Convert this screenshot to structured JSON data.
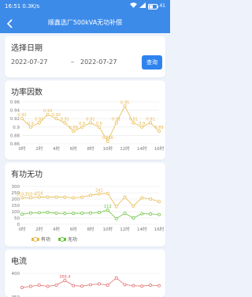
{
  "status": {
    "time": "16:51",
    "speed": "0.3K/s",
    "battery": "41"
  },
  "appbar": {
    "title": "顺鑫选厂500kVA无功补偿"
  },
  "date_card": {
    "title": "选择日期",
    "start": "2022-07-27",
    "sep": "–",
    "end": "2022-07-27",
    "query": "查询"
  },
  "pf_card": {
    "title": "功率因数"
  },
  "rp_card": {
    "title": "有功无功",
    "legend_active": "有功",
    "legend_reactive": "无功"
  },
  "cur_card": {
    "title": "电流"
  },
  "colors": {
    "primary": "#3d8be9",
    "active_series": "#e7b84a",
    "reactive_series": "#67c23a",
    "current_series": "#e36b6b"
  },
  "chart_data": [
    {
      "type": "line",
      "title": "功率因数",
      "categories": [
        "0时",
        "1时",
        "2时",
        "3时",
        "4时",
        "5时",
        "6时",
        "7时",
        "8时",
        "9时",
        "10时",
        "11时",
        "12时",
        "13时",
        "14时",
        "15时",
        "16时"
      ],
      "ylim": [
        0.86,
        0.96
      ],
      "yticks": [
        "0.96",
        "0.94",
        "0.92",
        "0.9",
        "0.88",
        "0.86"
      ],
      "series": [
        {
          "values": [
            0.92,
            0.9,
            0.91,
            0.93,
            0.92,
            0.91,
            0.89,
            0.9,
            0.91,
            0.9,
            0.866,
            0.91,
            0.95,
            0.91,
            0.9,
            0.91,
            0.89
          ]
        }
      ],
      "labels": [
        "0.92",
        "0.9",
        "0.91",
        "0.93",
        "0.92",
        "0.91",
        "0.89",
        "0.9",
        "0.91",
        "0.9",
        "0.866",
        "0.91",
        "0.95",
        "0.91",
        "0.9",
        "0.91",
        "0.89"
      ],
      "grid": true
    },
    {
      "type": "line",
      "title": "有功无功",
      "categories": [
        "0时",
        "1时",
        "2时",
        "3时",
        "4时",
        "5时",
        "6时",
        "7时",
        "8时",
        "9时",
        "10时",
        "11时",
        "12时",
        "13时",
        "14时",
        "15时",
        "16时"
      ],
      "ylim": [
        0,
        300
      ],
      "yticks": [
        "300",
        "250",
        "200",
        "150",
        "100",
        "50",
        "0"
      ],
      "series": [
        {
          "name": "有功",
          "values": [
            210.2,
            210.4,
            216,
            215,
            216,
            215,
            210,
            215,
            230,
            241,
            245,
            140,
            215,
            145,
            210,
            200,
            180
          ]
        },
        {
          "name": "无功",
          "values": [
            80,
            90,
            92,
            95,
            88,
            86,
            87,
            88,
            90,
            94,
            112,
            45,
            88,
            50,
            84,
            82,
            78
          ]
        }
      ],
      "labels_active": [
        "210.2",
        "210.4",
        "216",
        "",
        "",
        "",
        "",
        "",
        "",
        "241",
        "",
        "",
        "",
        "",
        "",
        "",
        ""
      ],
      "labels_reactive": [
        "",
        "",
        "",
        "",
        "",
        "",
        "",
        "",
        "",
        "",
        "112",
        "",
        "",
        "",
        "",
        "",
        ""
      ],
      "legend": "bottom",
      "grid": true
    },
    {
      "type": "line",
      "title": "电流",
      "ylim": [
        300,
        400
      ],
      "yticks": [
        "400",
        "350"
      ],
      "series": [
        {
          "values": [
            340,
            345,
            350,
            345,
            350,
            370,
            348,
            346,
            352,
            355,
            350,
            380,
            352,
            348,
            346,
            350,
            348
          ]
        }
      ],
      "labels": [
        "",
        "",
        "",
        "",
        "",
        "388.4",
        "",
        "",
        "",
        "",
        "",
        "",
        "",
        "",
        "",
        "",
        ""
      ],
      "grid": true
    }
  ]
}
